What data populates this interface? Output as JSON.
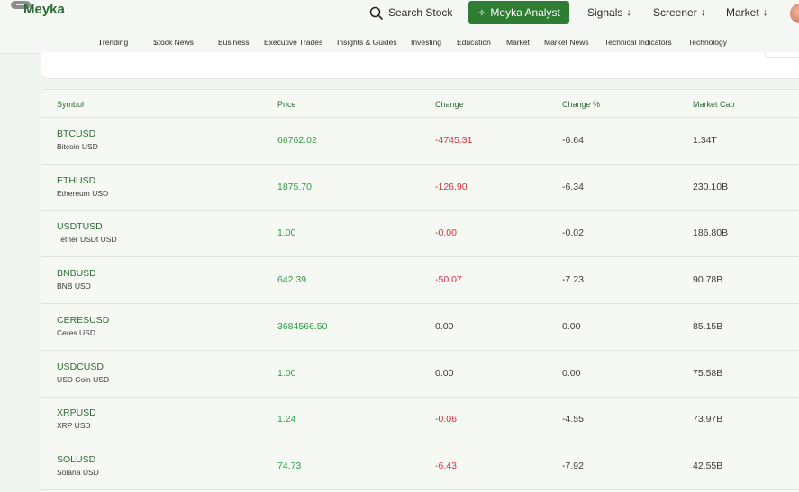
{
  "header": {
    "brand": "Meyka",
    "search_label": "Search Stock",
    "analyst_label": "Meyka Analyst",
    "nav": [
      "Signals",
      "Screener",
      "Market"
    ]
  },
  "subnav": [
    "Trending",
    "Stock News",
    "Business",
    "Executive Trades",
    "Insights & Guides",
    "Investing",
    "Education",
    "Market",
    "Market News",
    "Technical Indicators",
    "Technology"
  ],
  "subnav_arrows": [
    true,
    true,
    false,
    false,
    false,
    false,
    false,
    false,
    false,
    false,
    false
  ],
  "table": {
    "columns": [
      "Symbol",
      "Price",
      "Change",
      "Change %",
      "Market Cap"
    ],
    "rows": [
      {
        "symbol": "BTCUSD",
        "name": "Bitcoin USD",
        "price": "66762.02",
        "change": "-4745.31",
        "change_pct": "-6.64",
        "market_cap": "1.34T"
      },
      {
        "symbol": "ETHUSD",
        "name": "Ethereum USD",
        "price": "1875.70",
        "change": "-126.90",
        "change_pct": "-6.34",
        "market_cap": "230.10B"
      },
      {
        "symbol": "USDTUSD",
        "name": "Tether USDt USD",
        "price": "1.00",
        "change": "-0.00",
        "change_pct": "-0.02",
        "market_cap": "186.80B"
      },
      {
        "symbol": "BNBUSD",
        "name": "BNB USD",
        "price": "642.39",
        "change": "-50.07",
        "change_pct": "-7.23",
        "market_cap": "90.78B"
      },
      {
        "symbol": "CERESUSD",
        "name": "Ceres USD",
        "price": "3684566.50",
        "change": "0.00",
        "change_pct": "0.00",
        "market_cap": "85.15B"
      },
      {
        "symbol": "USDCUSD",
        "name": "USD Coin USD",
        "price": "1.00",
        "change": "0.00",
        "change_pct": "0.00",
        "market_cap": "75.58B"
      },
      {
        "symbol": "XRPUSD",
        "name": "XRP USD",
        "price": "1.24",
        "change": "-0.06",
        "change_pct": "-4.55",
        "market_cap": "73.97B"
      },
      {
        "symbol": "SOLUSD",
        "name": "Solana USD",
        "price": "74.73",
        "change": "-6.43",
        "change_pct": "-7.92",
        "market_cap": "42.55B"
      }
    ]
  },
  "colors": {
    "brand_green": "#2e7d32",
    "positive": "#2e9d44",
    "negative": "#d6333f"
  }
}
